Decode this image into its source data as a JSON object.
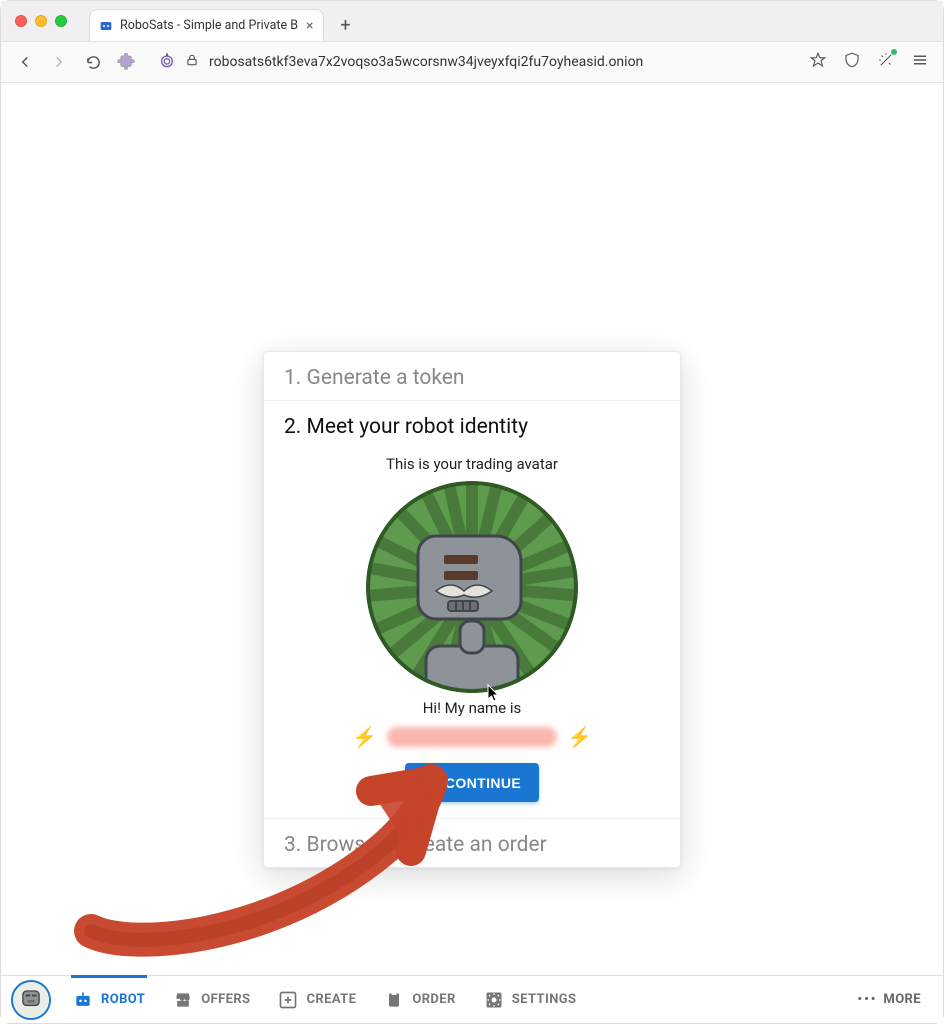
{
  "browser": {
    "tab_title": "RoboSats - Simple and Private B",
    "url": "robosats6tkf3eva7x2voqso3a5wcorsnw34jveyxfqi2fu7oyheasid.onion"
  },
  "card": {
    "step1": "1. Generate a token",
    "step2": "2. Meet your robot identity",
    "step3": "3. Browse or create an order",
    "subtitle": "This is your trading avatar",
    "greeting": "Hi! My name is",
    "continue_label": "CONTINUE"
  },
  "nav": {
    "robot": "ROBOT",
    "offers": "OFFERS",
    "create": "CREATE",
    "order": "ORDER",
    "settings": "SETTINGS",
    "more": "MORE"
  }
}
